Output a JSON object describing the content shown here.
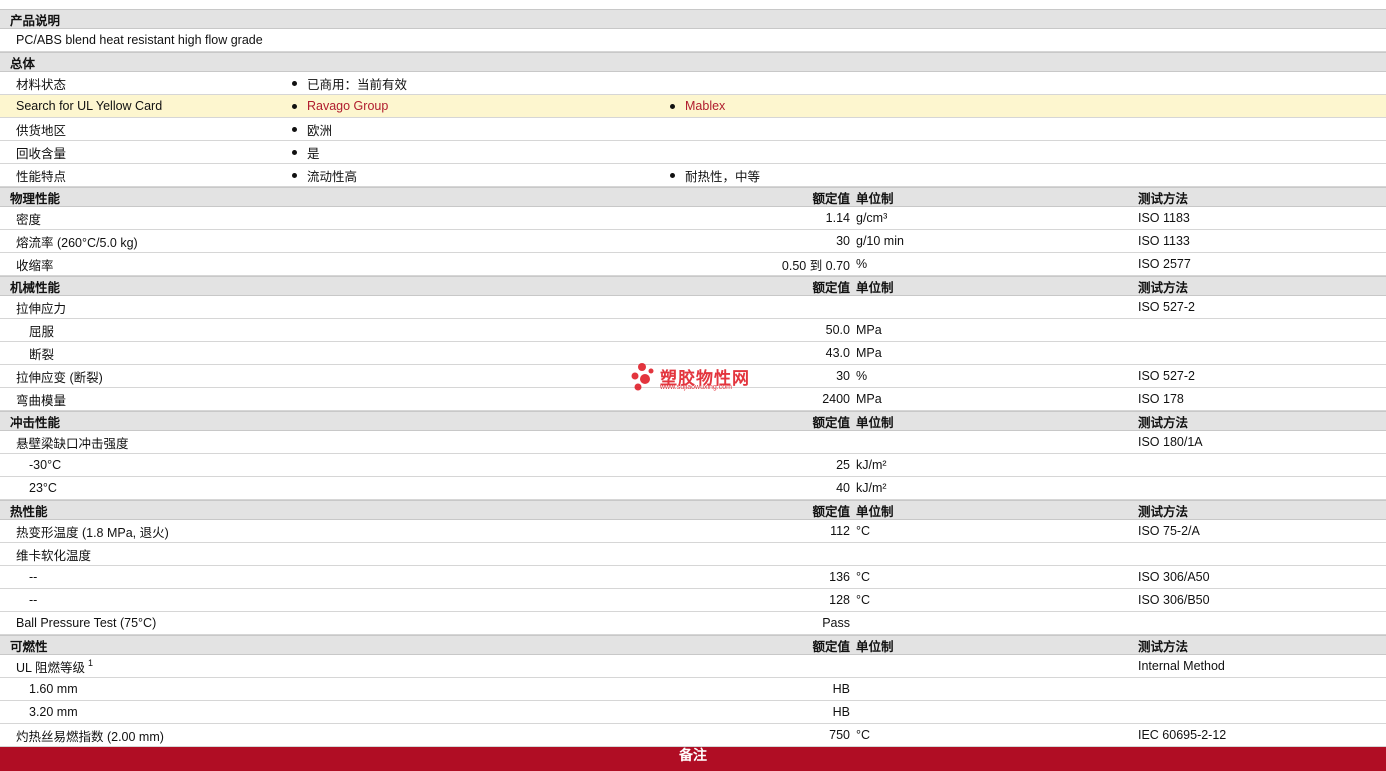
{
  "rows": [
    {
      "type": "sec",
      "label": "产品说明"
    },
    {
      "type": "plain",
      "label": "PC/ABS blend heat resistant high flow grade"
    },
    {
      "type": "sec",
      "label": "总体"
    },
    {
      "type": "bul",
      "label": "材料状态",
      "b1": "已商用：当前有效"
    },
    {
      "type": "bul",
      "label": "Search for UL Yellow Card",
      "b1": "Ravago Group",
      "b2": "Mablex",
      "hl": true,
      "link": true
    },
    {
      "type": "bul",
      "label": "供货地区",
      "b1": "欧洲"
    },
    {
      "type": "bul",
      "label": "回收含量",
      "b1": "是"
    },
    {
      "type": "bul",
      "label": "性能特点",
      "b1": "流动性高",
      "b2": "耐热性，中等"
    },
    {
      "type": "sec",
      "label": "物理性能",
      "value": "额定值",
      "unit": "单位制",
      "test": "测试方法"
    },
    {
      "type": "data",
      "label": "密度",
      "value": "1.14",
      "unit": "g/cm³",
      "test": "ISO 1183"
    },
    {
      "type": "data",
      "label": "熔流率 (260°C/5.0 kg)",
      "value": "30",
      "unit": "g/10 min",
      "test": "ISO 1133"
    },
    {
      "type": "data",
      "label": "收缩率",
      "value": "0.50 到  0.70",
      "unit": "%",
      "test": "ISO 2577"
    },
    {
      "type": "sec",
      "label": "机械性能",
      "value": "额定值",
      "unit": "单位制",
      "test": "测试方法"
    },
    {
      "type": "data",
      "label": "拉伸应力",
      "value": "",
      "unit": "",
      "test": "ISO 527-2"
    },
    {
      "type": "data",
      "label": "屈服",
      "indent": true,
      "value": "50.0",
      "unit": "MPa",
      "test": ""
    },
    {
      "type": "data",
      "label": "断裂",
      "indent": true,
      "value": "43.0",
      "unit": "MPa",
      "test": ""
    },
    {
      "type": "data",
      "label": "拉伸应变 (断裂)",
      "value": "30",
      "unit": "%",
      "test": "ISO 527-2"
    },
    {
      "type": "data",
      "label": "弯曲模量",
      "value": "2400",
      "unit": "MPa",
      "test": "ISO 178"
    },
    {
      "type": "sec",
      "label": "冲击性能",
      "value": "额定值",
      "unit": "单位制",
      "test": "测试方法"
    },
    {
      "type": "data",
      "label": "悬壁梁缺口冲击强度",
      "value": "",
      "unit": "",
      "test": "ISO 180/1A"
    },
    {
      "type": "data",
      "label": "-30°C",
      "indent": true,
      "value": "25",
      "unit": "kJ/m²",
      "test": ""
    },
    {
      "type": "data",
      "label": "23°C",
      "indent": true,
      "value": "40",
      "unit": "kJ/m²",
      "test": ""
    },
    {
      "type": "sec",
      "label": "热性能",
      "value": "额定值",
      "unit": "单位制",
      "test": "测试方法"
    },
    {
      "type": "data",
      "label": "热变形温度 (1.8 MPa, 退火)",
      "value": "112",
      "unit": "°C",
      "test": "ISO 75-2/A"
    },
    {
      "type": "data",
      "label": "维卡软化温度",
      "value": "",
      "unit": "",
      "test": ""
    },
    {
      "type": "data",
      "label": "--",
      "indent": true,
      "value": "136",
      "unit": "°C",
      "test": "ISO 306/A50"
    },
    {
      "type": "data",
      "label": "--",
      "indent": true,
      "value": "128",
      "unit": "°C",
      "test": "ISO 306/B50"
    },
    {
      "type": "data",
      "label": "Ball Pressure Test (75°C)",
      "value": "Pass",
      "unit": "",
      "test": ""
    },
    {
      "type": "sec",
      "label": "可燃性",
      "value": "额定值",
      "unit": "单位制",
      "test": "测试方法"
    },
    {
      "type": "data",
      "label": "UL 阻燃等级",
      "sup": "1",
      "value": "",
      "unit": "",
      "test": "Internal Method"
    },
    {
      "type": "data",
      "label": "1.60 mm",
      "indent": true,
      "value": "HB",
      "unit": "",
      "test": ""
    },
    {
      "type": "data",
      "label": "3.20 mm",
      "indent": true,
      "value": "HB",
      "unit": "",
      "test": ""
    },
    {
      "type": "data",
      "label": "灼热丝易燃指数 (2.00 mm)",
      "value": "750",
      "unit": "°C",
      "test": "IEC 60695-2-12"
    }
  ],
  "footer": {
    "label": "备注"
  },
  "watermark": {
    "title": "塑胶物性网",
    "url": "www.sujiaowuxing.com"
  },
  "colors": {
    "section_bg": "#e3e3e3",
    "highlight_bg": "#fdf6cf",
    "link": "#b01c2e",
    "footer_bg": "#b00d24"
  }
}
